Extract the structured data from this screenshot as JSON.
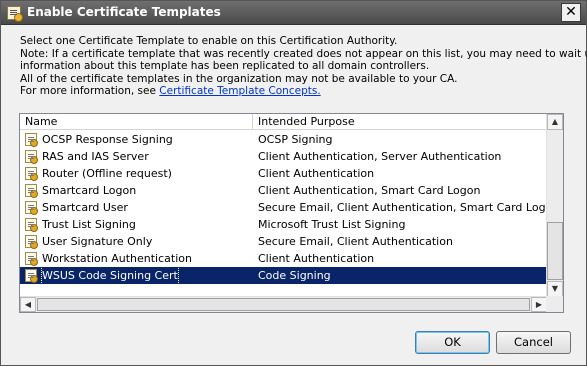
{
  "window": {
    "title": "Enable Certificate Templates",
    "close_glyph": "✕"
  },
  "description": {
    "line1": "Select one Certificate Template to enable on this Certification Authority.",
    "line2": "Note: If a certificate template that was recently created does not appear on this list, you may need to wait until",
    "line3": "information about this template has been replicated to all domain controllers.",
    "line4": "All of the certificate templates in the organization may not be available to your CA.",
    "line5_prefix": "For more information, see ",
    "link_text": "Certificate Template Concepts."
  },
  "list": {
    "columns": [
      "Name",
      "Intended Purpose"
    ],
    "rows": [
      {
        "name": "OCSP Response Signing",
        "purpose": "OCSP Signing",
        "selected": false
      },
      {
        "name": "RAS and IAS Server",
        "purpose": "Client Authentication, Server Authentication",
        "selected": false
      },
      {
        "name": "Router (Offline request)",
        "purpose": "Client Authentication",
        "selected": false
      },
      {
        "name": "Smartcard Logon",
        "purpose": "Client Authentication, Smart Card Logon",
        "selected": false
      },
      {
        "name": "Smartcard User",
        "purpose": "Secure Email, Client Authentication, Smart Card Logon",
        "selected": false
      },
      {
        "name": "Trust List Signing",
        "purpose": "Microsoft Trust List Signing",
        "selected": false
      },
      {
        "name": "User Signature Only",
        "purpose": "Secure Email, Client Authentication",
        "selected": false
      },
      {
        "name": "Workstation Authentication",
        "purpose": "Client Authentication",
        "selected": false
      },
      {
        "name": "WSUS Code Signing Cert",
        "purpose": "Code Signing",
        "selected": true
      }
    ]
  },
  "buttons": {
    "ok": "OK",
    "cancel": "Cancel"
  },
  "colors": {
    "selection": "#0a246a",
    "link": "#0033cc",
    "titlebar": "#5a5a5a"
  }
}
